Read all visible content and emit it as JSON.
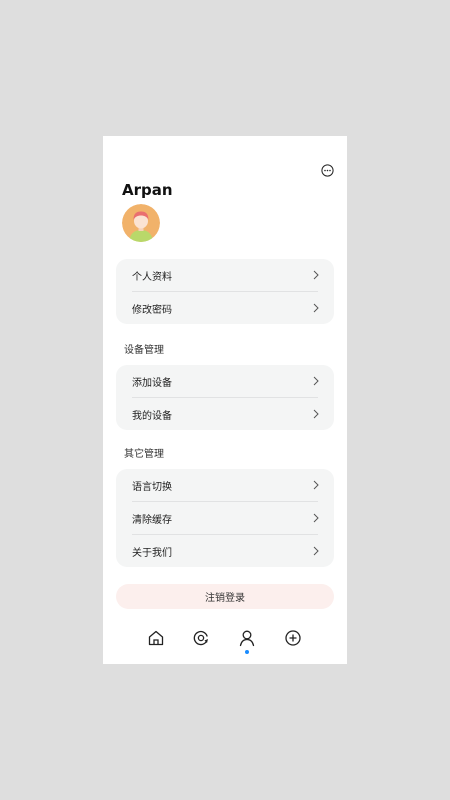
{
  "profile": {
    "username": "Arpan"
  },
  "account_menu": [
    {
      "label": "个人资料"
    },
    {
      "label": "修改密码"
    }
  ],
  "device_section": {
    "title": "设备管理",
    "items": [
      {
        "label": "添加设备"
      },
      {
        "label": "我的设备"
      }
    ]
  },
  "other_section": {
    "title": "其它管理",
    "items": [
      {
        "label": "语言切换"
      },
      {
        "label": "清除缓存"
      },
      {
        "label": "关于我们"
      }
    ]
  },
  "logout_label": "注销登录",
  "tabbar": {
    "items": [
      {
        "icon": "home-icon"
      },
      {
        "icon": "device-icon"
      },
      {
        "icon": "user-icon",
        "active": true
      },
      {
        "icon": "add-circle-icon"
      }
    ],
    "active_color": "#1a8cff"
  },
  "colors": {
    "card_bg": "#f4f5f5",
    "logout_bg": "#fcefed",
    "avatar_bg": "#f1b26a"
  }
}
